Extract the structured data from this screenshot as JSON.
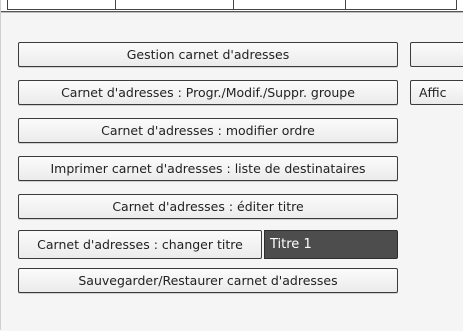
{
  "menu": {
    "manage_address_book": "Gestion carnet d'adresses",
    "group_program": "Carnet d'adresses : Progr./Modif./Suppr. groupe",
    "modify_order": "Carnet d'adresses : modifier ordre",
    "print_list": "Imprimer carnet d'adresses : liste de destinataires",
    "edit_title": "Carnet d'adresses : éditer titre",
    "change_title": "Carnet d'adresses : changer titre",
    "current_title": "Titre 1",
    "backup_restore": "Sauvegarder/Restaurer carnet d'adresses"
  },
  "right_column": {
    "partial_label": "Affic"
  }
}
